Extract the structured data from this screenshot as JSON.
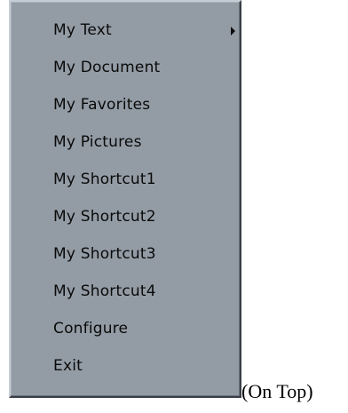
{
  "menu": {
    "items": [
      {
        "label": "My Text",
        "has_submenu": true
      },
      {
        "label": "My Document"
      },
      {
        "label": "My Favorites"
      },
      {
        "label": "My Pictures"
      },
      {
        "label": "My Shortcut1"
      },
      {
        "label": "My Shortcut2"
      },
      {
        "label": "My Shortcut3"
      },
      {
        "label": "My Shortcut4"
      },
      {
        "label": "Configure"
      },
      {
        "label": "Exit"
      }
    ],
    "submenu_icon": "triangle-right-icon"
  },
  "caption": "(On Top)"
}
